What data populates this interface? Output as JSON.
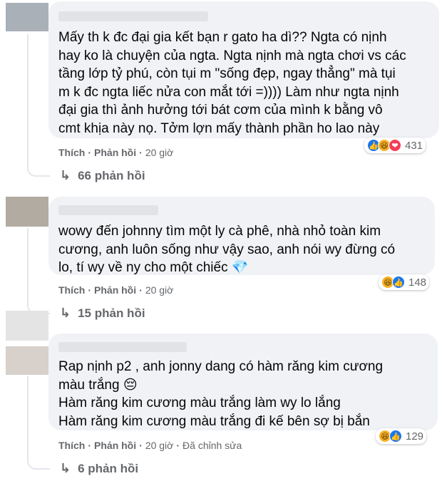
{
  "comments": [
    {
      "text": "Mấy th   k đc đại gia kết bạn r gato ha dì?? Ngta có nịnh\nhay ko là chuyện của ngta. Ngta nịnh mà ngta chơi vs các\ntầng lớp tỷ phú, còn tụi m \"sống đẹp, ngay thẳng\" mà tụi\nm k đc ngta liếc nửa con mắt tới =)))) Làm như ngta nịnh\nđại gia thì ảnh hưởng tới bát cơm của mình k bằng vô\ncmt khịa này nọ. Tởm lợn mấy thành phần ho lao này",
      "reaction_count": "431",
      "like": "Thích",
      "reply": "Phản hồi",
      "time": "20 giờ",
      "replies": "66 phản hồi"
    },
    {
      "text": "wowy đến johnny tìm một ly cà phê, nhà nhỏ toàn kim\ncương, anh luôn sống như vậy sao, anh nói wy đừng có\nlo, tí wy về ny cho một chiếc 💎",
      "reaction_count": "148",
      "like": "Thích",
      "reply": "Phản hồi",
      "time": "20 giờ",
      "replies": "15 phản hồi"
    },
    {
      "text": "Rap nịnh p2 , anh jonny dang có hàm răng kim cương\nmàu trắng 😔\nHàm răng kim cương màu trắng làm wy lo lắng\nHàm răng kim cương màu trắng đi kế bên sợ bị bắn",
      "reaction_count": "129",
      "like": "Thích",
      "reply": "Phản hồi",
      "time": "20 giờ",
      "edited": "Đã chỉnh sửa",
      "replies": "6 phản hồi"
    }
  ],
  "separator": "·",
  "reply_arrow": "↳",
  "emoji_icons": {
    "like": "👍",
    "haha": "😆",
    "love": "❤"
  }
}
